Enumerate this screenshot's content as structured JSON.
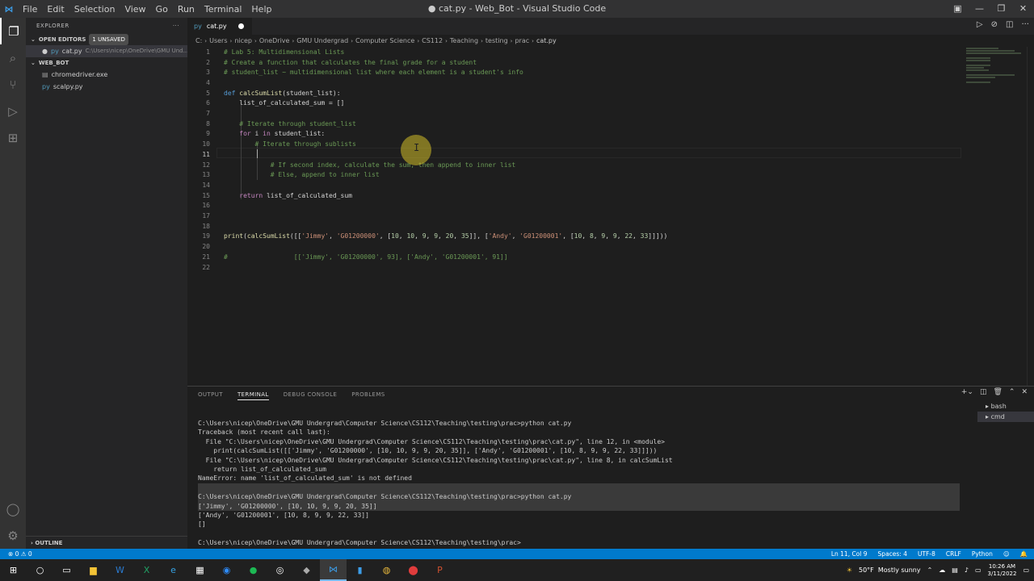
{
  "window": {
    "title": "● cat.py - Web_Bot - Visual Studio Code",
    "menu": [
      "File",
      "Edit",
      "Selection",
      "View",
      "Go",
      "Run",
      "Terminal",
      "Help"
    ],
    "controls": [
      "—",
      "❐",
      "✕"
    ]
  },
  "activity_bar": {
    "items": [
      "explorer-icon",
      "search-icon",
      "source-control-icon",
      "run-debug-icon",
      "extensions-icon"
    ],
    "bottom": [
      "account-icon",
      "settings-icon"
    ]
  },
  "sidebar": {
    "title": "EXPLORER",
    "open_editors": {
      "label": "OPEN EDITORS",
      "badge": "1 UNSAVED",
      "items": [
        {
          "name": "cat.py",
          "path": "C:\\Users\\nicep\\OneDrive\\GMU Und..."
        }
      ]
    },
    "workspace": {
      "label": "WEB_BOT",
      "files": [
        "chromedriver.exe",
        "scalpy.py"
      ]
    },
    "outline_label": "OUTLINE"
  },
  "editor": {
    "tab": {
      "label": "cat.py"
    },
    "breadcrumbs": [
      "C:",
      "Users",
      "nicep",
      "OneDrive",
      "GMU Undergrad",
      "Computer Science",
      "CS112",
      "Teaching",
      "testing",
      "prac",
      "cat.py"
    ],
    "current_line": "11",
    "lines": [
      {
        "n": "1",
        "t": "# Lab 5: Multidimensional Lists"
      },
      {
        "n": "2",
        "t": "# Create a function that calculates the final grade for a student"
      },
      {
        "n": "3",
        "t": "# student_list ~ multidimensional list where each element is a student's info"
      },
      {
        "n": "4",
        "t": ""
      },
      {
        "n": "5",
        "t": "def calcSumList(student_list):"
      },
      {
        "n": "6",
        "t": "    list_of_calculated_sum = []"
      },
      {
        "n": "7",
        "t": ""
      },
      {
        "n": "8",
        "t": "    # Iterate through student_list"
      },
      {
        "n": "9",
        "t": "    for i in student_list:"
      },
      {
        "n": "10",
        "t": "        # Iterate through sublists"
      },
      {
        "n": "11",
        "t": "        "
      },
      {
        "n": "12",
        "t": "            # If second index, calculate the sum, then append to inner list"
      },
      {
        "n": "13",
        "t": "            # Else, append to inner list"
      },
      {
        "n": "14",
        "t": ""
      },
      {
        "n": "15",
        "t": "    return list_of_calculated_sum"
      },
      {
        "n": "16",
        "t": ""
      },
      {
        "n": "17",
        "t": ""
      },
      {
        "n": "18",
        "t": ""
      },
      {
        "n": "19",
        "t": "print(calcSumList([['Jimmy', 'G01200000', [10, 10, 9, 9, 20, 35]], ['Andy', 'G01200001', [10, 8, 9, 9, 22, 33]]]))"
      },
      {
        "n": "20",
        "t": ""
      },
      {
        "n": "21",
        "t": "#                 [['Jimmy', 'G01200000', 93], ['Andy', 'G01200001', 91]]"
      },
      {
        "n": "22",
        "t": ""
      }
    ]
  },
  "panel": {
    "tabs": [
      "OUTPUT",
      "TERMINAL",
      "DEBUG CONSOLE",
      "PROBLEMS"
    ],
    "active_tab": "TERMINAL",
    "terminals": [
      "bash",
      "cmd"
    ],
    "terminal_lines": [
      "C:\\Users\\nicep\\OneDrive\\GMU Undergrad\\Computer Science\\CS112\\Teaching\\testing\\prac>python cat.py",
      "Traceback (most recent call last):",
      "  File \"C:\\Users\\nicep\\OneDrive\\GMU Undergrad\\Computer Science\\CS112\\Teaching\\testing\\prac\\cat.py\", line 12, in <module>",
      "    print(calcSumList([['Jimmy', 'G01200000', [10, 10, 9, 9, 20, 35]], ['Andy', 'G01200001', [10, 8, 9, 9, 22, 33]]]))",
      "  File \"C:\\Users\\nicep\\OneDrive\\GMU Undergrad\\Computer Science\\CS112\\Teaching\\testing\\prac\\cat.py\", line 8, in calcSumList",
      "    return list_of_calculated_sum",
      "NameError: name 'list_of_calculated_sum' is not defined",
      "",
      "C:\\Users\\nicep\\OneDrive\\GMU Undergrad\\Computer Science\\CS112\\Teaching\\testing\\prac>python cat.py",
      "['Jimmy', 'G01200000', [10, 10, 9, 9, 20, 35]]",
      "['Andy', 'G01200001', [10, 8, 9, 9, 22, 33]]",
      "[]",
      "",
      "C:\\Users\\nicep\\OneDrive\\GMU Undergrad\\Computer Science\\CS112\\Teaching\\testing\\prac>"
    ]
  },
  "status_bar": {
    "problems": "⊗ 0 ⚠ 0",
    "position": "Ln 11, Col 9",
    "spaces": "Spaces: 4",
    "encoding": "UTF-8",
    "eol": "CRLF",
    "language": "Python"
  },
  "taskbar": {
    "apps": [
      "windows-icon",
      "search-icon",
      "task-view-icon",
      "file-explorer-icon",
      "word-icon",
      "excel-icon",
      "edge-icon",
      "store-icon",
      "zoom-icon",
      "spotify-icon",
      "obs-icon",
      "git-icon",
      "vscode-icon",
      "app-icon",
      "chrome-icon",
      "recorder-icon",
      "powerpoint-icon"
    ],
    "weather": "50°F  Mostly sunny",
    "time": "10:26 AM",
    "date": "3/11/2022"
  },
  "colors": {
    "accent": "#007acc",
    "editor_bg": "#1e1e1e",
    "comment": "#6a9955",
    "keyword_def": "#569cd6",
    "function": "#dcdcaa",
    "string": "#ce9178"
  }
}
